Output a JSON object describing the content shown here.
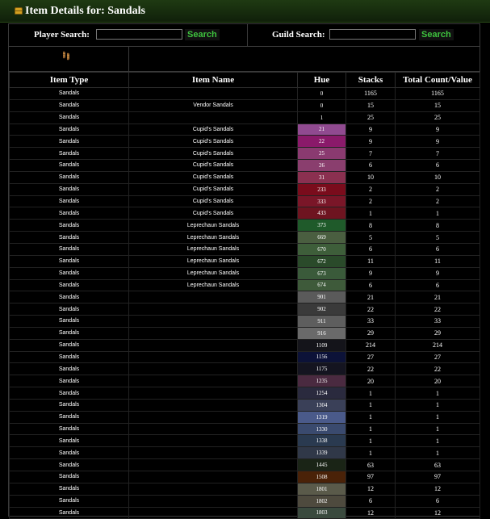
{
  "header": {
    "title": "Item Details for: Sandals",
    "icon": "treasure-chest-icon"
  },
  "search": {
    "player_label": "Player Search:",
    "player_button": "Search",
    "guild_label": "Guild Search:",
    "guild_button": "Search"
  },
  "table": {
    "columns": [
      "Item Type",
      "Item Name",
      "Hue",
      "Stacks",
      "Total Count/Value"
    ],
    "rows": [
      {
        "type": "Sandals",
        "name": "",
        "hue": "0",
        "hue_color": "#000000",
        "stacks": "1165",
        "total": "1165"
      },
      {
        "type": "Sandals",
        "name": "Vendor Sandals",
        "hue": "0",
        "hue_color": "#000000",
        "stacks": "15",
        "total": "15"
      },
      {
        "type": "Sandals",
        "name": "",
        "hue": "1",
        "hue_color": "#000000",
        "stacks": "25",
        "total": "25"
      },
      {
        "type": "Sandals",
        "name": "Cupid's Sandals",
        "hue": "21",
        "hue_color": "#904a90",
        "stacks": "9",
        "total": "9"
      },
      {
        "type": "Sandals",
        "name": "Cupid's Sandals",
        "hue": "22",
        "hue_color": "#8a1a6a",
        "stacks": "9",
        "total": "9"
      },
      {
        "type": "Sandals",
        "name": "Cupid's Sandals",
        "hue": "25",
        "hue_color": "#8a3a70",
        "stacks": "7",
        "total": "7"
      },
      {
        "type": "Sandals",
        "name": "Cupid's Sandals",
        "hue": "26",
        "hue_color": "#8a3e6e",
        "stacks": "6",
        "total": "6"
      },
      {
        "type": "Sandals",
        "name": "Cupid's Sandals",
        "hue": "31",
        "hue_color": "#8a3050",
        "stacks": "10",
        "total": "10"
      },
      {
        "type": "Sandals",
        "name": "Cupid's Sandals",
        "hue": "233",
        "hue_color": "#7a0c1c",
        "stacks": "2",
        "total": "2"
      },
      {
        "type": "Sandals",
        "name": "Cupid's Sandals",
        "hue": "333",
        "hue_color": "#7a1628",
        "stacks": "2",
        "total": "2"
      },
      {
        "type": "Sandals",
        "name": "Cupid's Sandals",
        "hue": "433",
        "hue_color": "#6e1420",
        "stacks": "1",
        "total": "1"
      },
      {
        "type": "Sandals",
        "name": "Leprechaun Sandals",
        "hue": "373",
        "hue_color": "#1f5a2a",
        "stacks": "8",
        "total": "8"
      },
      {
        "type": "Sandals",
        "name": "Leprechaun Sandals",
        "hue": "669",
        "hue_color": "#4a5e40",
        "stacks": "5",
        "total": "5"
      },
      {
        "type": "Sandals",
        "name": "Leprechaun Sandals",
        "hue": "670",
        "hue_color": "#3e5e3a",
        "stacks": "6",
        "total": "6"
      },
      {
        "type": "Sandals",
        "name": "Leprechaun Sandals",
        "hue": "672",
        "hue_color": "#2a4a2a",
        "stacks": "11",
        "total": "11"
      },
      {
        "type": "Sandals",
        "name": "Leprechaun Sandals",
        "hue": "673",
        "hue_color": "#3a5a3a",
        "stacks": "9",
        "total": "9"
      },
      {
        "type": "Sandals",
        "name": "Leprechaun Sandals",
        "hue": "674",
        "hue_color": "#3e5a3a",
        "stacks": "6",
        "total": "6"
      },
      {
        "type": "Sandals",
        "name": "",
        "hue": "901",
        "hue_color": "#5a5a5a",
        "stacks": "21",
        "total": "21"
      },
      {
        "type": "Sandals",
        "name": "",
        "hue": "902",
        "hue_color": "#3a3a3a",
        "stacks": "22",
        "total": "22"
      },
      {
        "type": "Sandals",
        "name": "",
        "hue": "911",
        "hue_color": "#5e5e5e",
        "stacks": "33",
        "total": "33"
      },
      {
        "type": "Sandals",
        "name": "",
        "hue": "916",
        "hue_color": "#6a6a6a",
        "stacks": "29",
        "total": "29"
      },
      {
        "type": "Sandals",
        "name": "",
        "hue": "1109",
        "hue_color": "#14141a",
        "stacks": "214",
        "total": "214"
      },
      {
        "type": "Sandals",
        "name": "",
        "hue": "1156",
        "hue_color": "#0c1238",
        "stacks": "27",
        "total": "27"
      },
      {
        "type": "Sandals",
        "name": "",
        "hue": "1175",
        "hue_color": "#141420",
        "stacks": "22",
        "total": "22"
      },
      {
        "type": "Sandals",
        "name": "",
        "hue": "1235",
        "hue_color": "#4a2a40",
        "stacks": "20",
        "total": "20"
      },
      {
        "type": "Sandals",
        "name": "",
        "hue": "1254",
        "hue_color": "#2a2a3e",
        "stacks": "1",
        "total": "1"
      },
      {
        "type": "Sandals",
        "name": "",
        "hue": "1304",
        "hue_color": "#3a4058",
        "stacks": "1",
        "total": "1"
      },
      {
        "type": "Sandals",
        "name": "",
        "hue": "1319",
        "hue_color": "#4a5a8a",
        "stacks": "1",
        "total": "1"
      },
      {
        "type": "Sandals",
        "name": "",
        "hue": "1330",
        "hue_color": "#3a4a6e",
        "stacks": "1",
        "total": "1"
      },
      {
        "type": "Sandals",
        "name": "",
        "hue": "1338",
        "hue_color": "#2a3a50",
        "stacks": "1",
        "total": "1"
      },
      {
        "type": "Sandals",
        "name": "",
        "hue": "1339",
        "hue_color": "#303848",
        "stacks": "1",
        "total": "1"
      },
      {
        "type": "Sandals",
        "name": "",
        "hue": "1445",
        "hue_color": "#1a2416",
        "stacks": "63",
        "total": "63"
      },
      {
        "type": "Sandals",
        "name": "",
        "hue": "1508",
        "hue_color": "#4a2208",
        "stacks": "97",
        "total": "97"
      },
      {
        "type": "Sandals",
        "name": "",
        "hue": "1801",
        "hue_color": "#5a5a4a",
        "stacks": "12",
        "total": "12"
      },
      {
        "type": "Sandals",
        "name": "",
        "hue": "1802",
        "hue_color": "#4e4a3e",
        "stacks": "6",
        "total": "6"
      },
      {
        "type": "Sandals",
        "name": "",
        "hue": "1803",
        "hue_color": "#3a4a3e",
        "stacks": "12",
        "total": "12"
      }
    ]
  }
}
